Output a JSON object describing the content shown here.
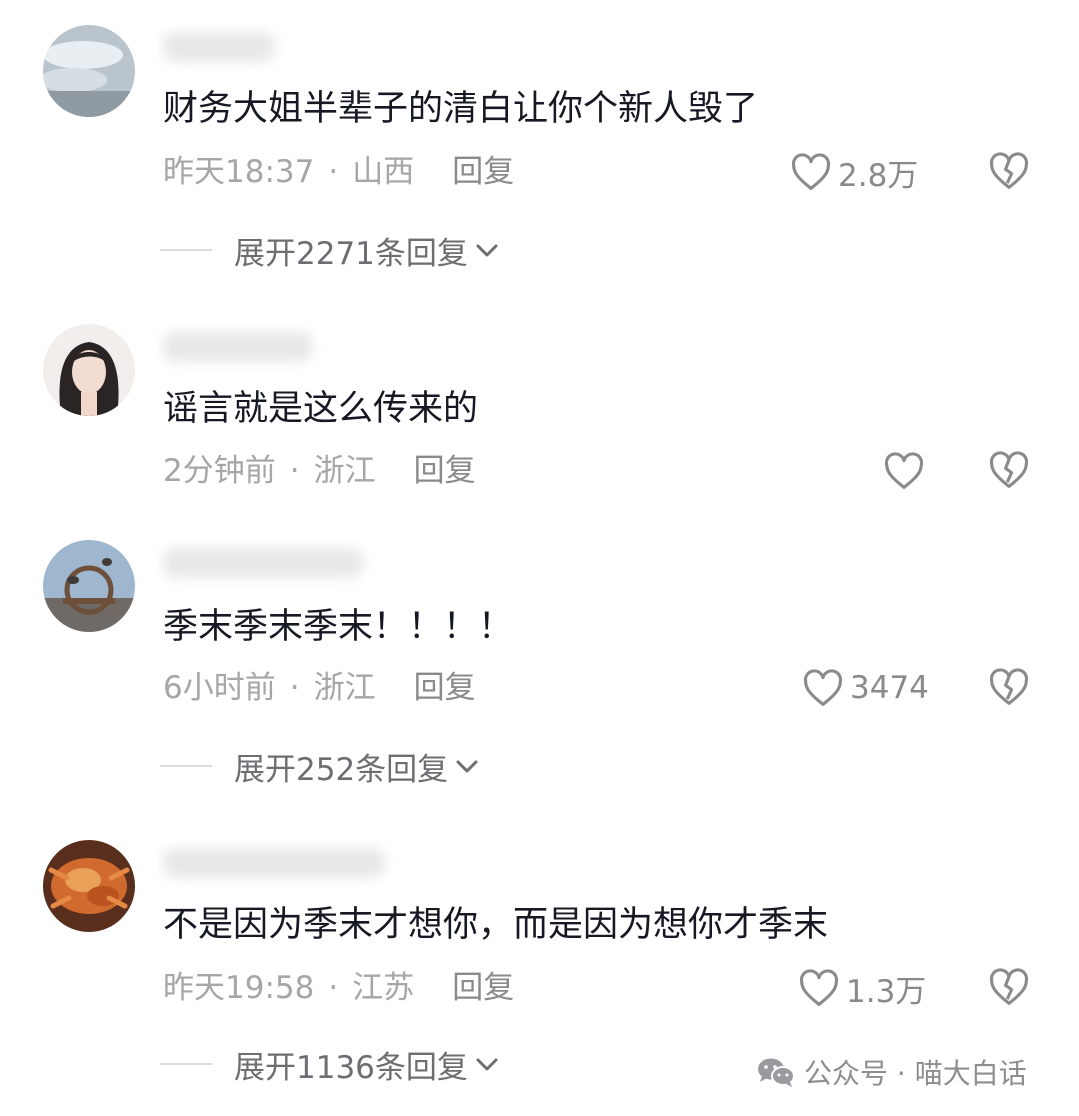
{
  "comments": [
    {
      "content": "财务大姐半辈子的清白让你个新人毁了",
      "time": "昨天18:37",
      "location": "山西",
      "reply_label": "回复",
      "likes": "2.8万",
      "expand_label": "展开2271条回复"
    },
    {
      "content": "谣言就是这么传来的",
      "time": "2分钟前",
      "location": "浙江",
      "reply_label": "回复",
      "likes": ""
    },
    {
      "content": "季末季末季末！！！！",
      "time": "6小时前",
      "location": "浙江",
      "reply_label": "回复",
      "likes": "3474",
      "expand_label": "展开252条回复"
    },
    {
      "content": "不是因为季末才想你，而是因为想你才季末",
      "time": "昨天19:58",
      "location": "江苏",
      "reply_label": "回复",
      "likes": "1.3万",
      "expand_label": "展开1136条回复"
    }
  ],
  "separator": "·",
  "watermark": {
    "icon": "wechat-icon",
    "text": "公众号 · 喵大白话"
  },
  "colors": {
    "text": "#161823",
    "meta": "#a6a6a9",
    "icon": "#8a8a8d"
  }
}
